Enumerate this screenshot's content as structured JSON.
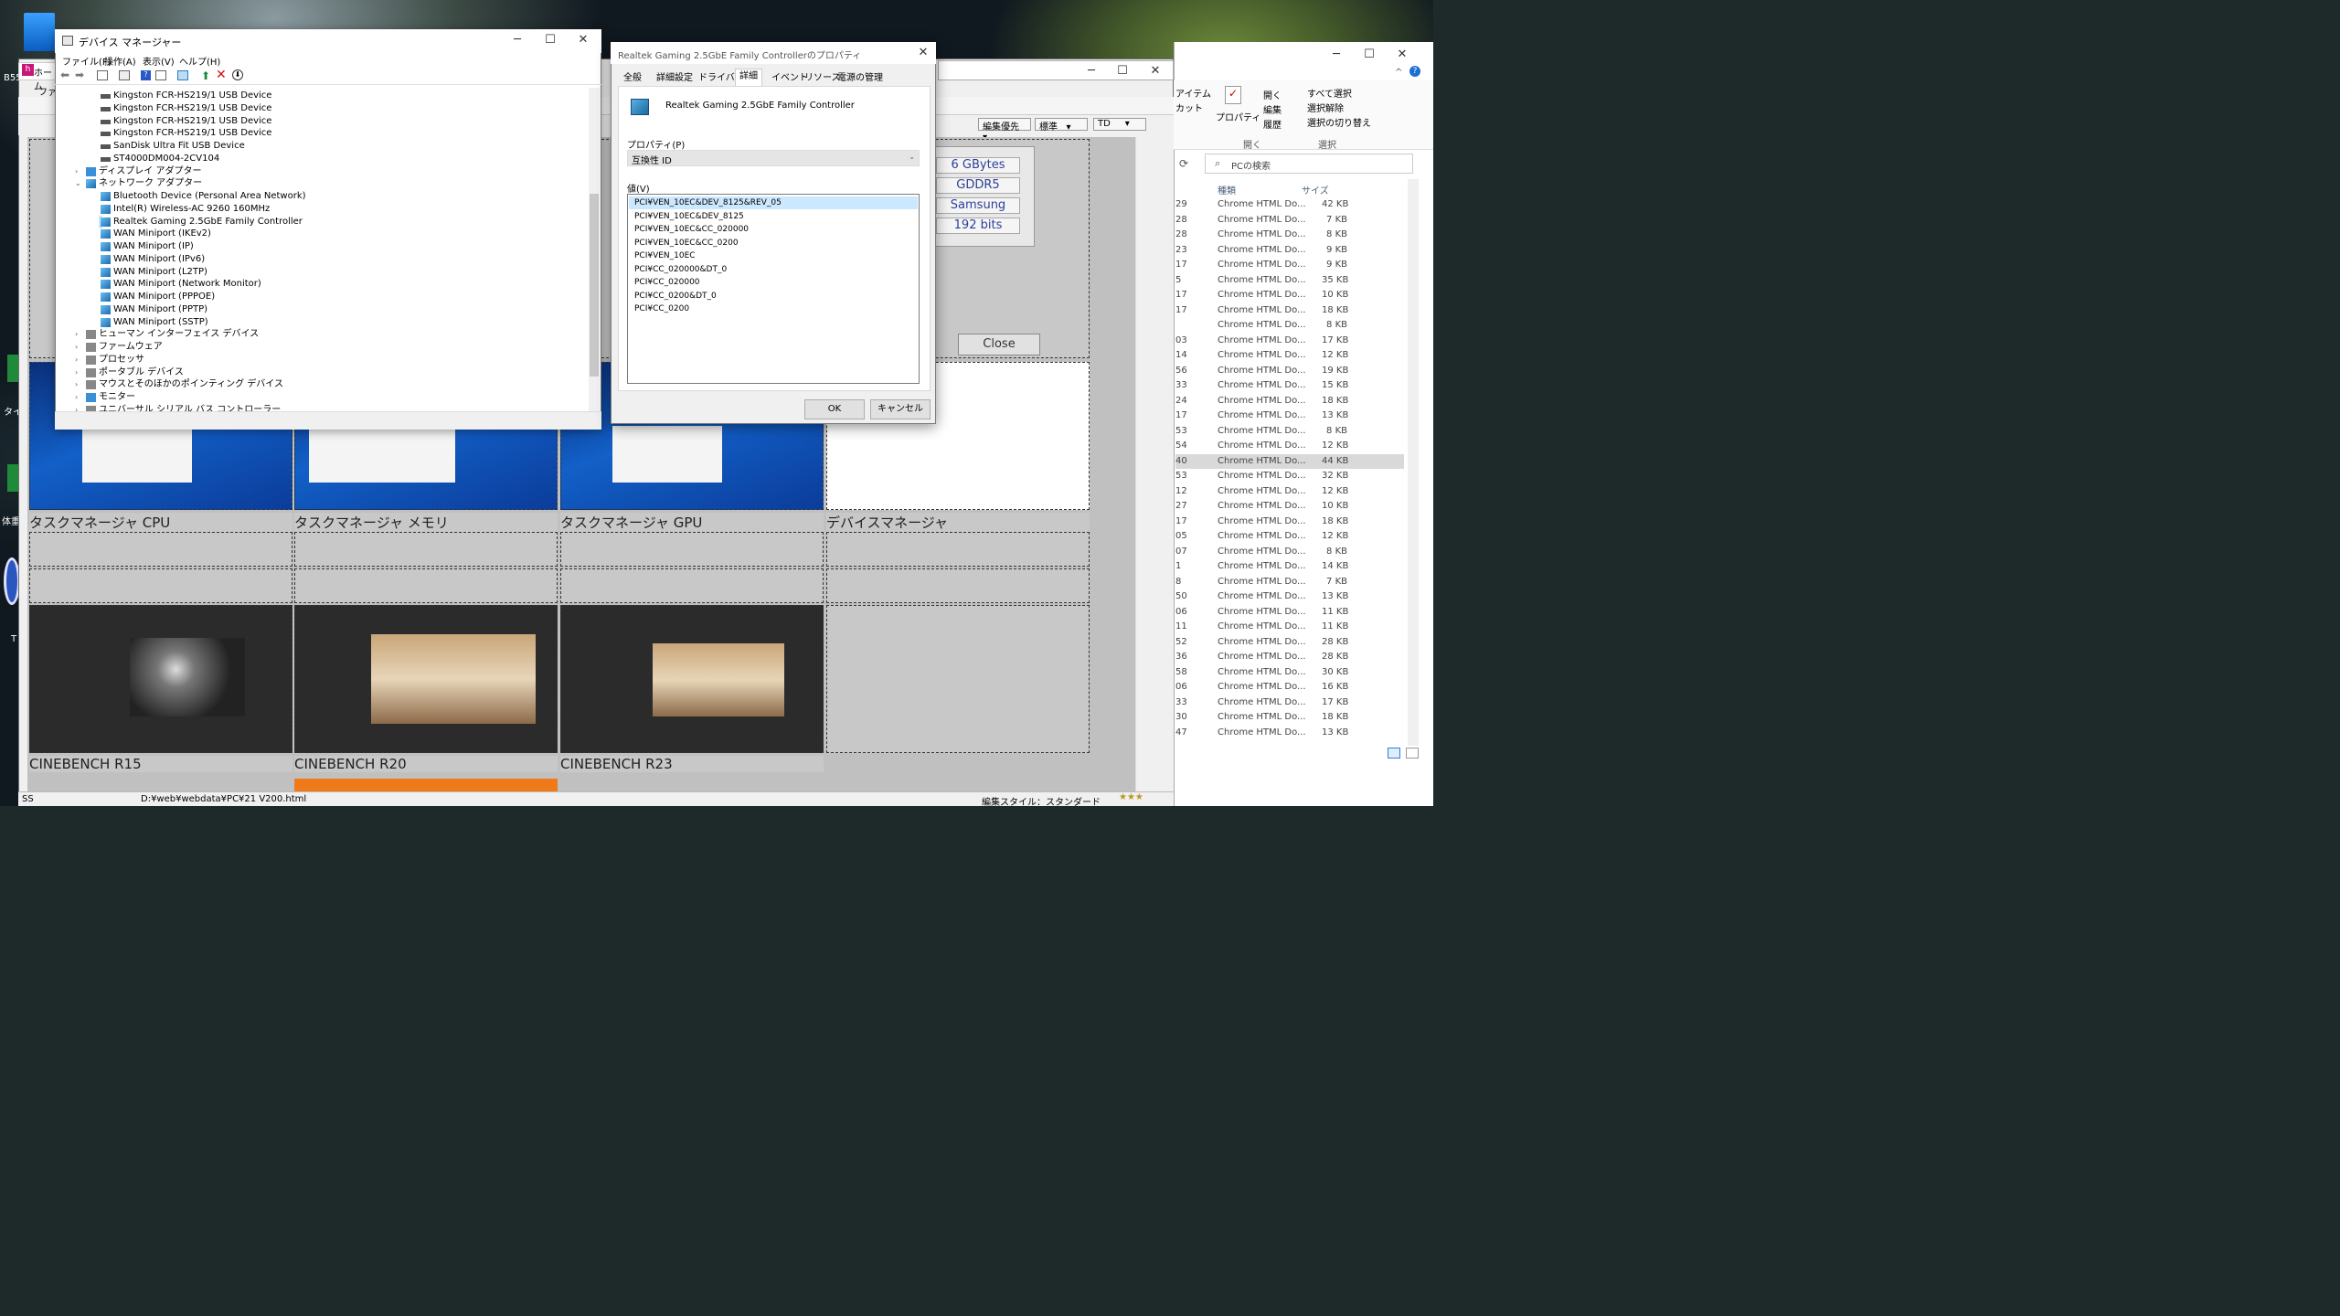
{
  "device_manager": {
    "title": "デバイス マネージャー",
    "menu": [
      "ファイル(F)",
      "操作(A)",
      "表示(V)",
      "ヘルプ(H)"
    ],
    "tree": [
      {
        "label": "Kingston FCR-HS219/1 USB Device",
        "level": 2,
        "icon": "drive-icon"
      },
      {
        "label": "Kingston FCR-HS219/1 USB Device",
        "level": 2,
        "icon": "drive-icon"
      },
      {
        "label": "Kingston FCR-HS219/1 USB Device",
        "level": 2,
        "icon": "drive-icon"
      },
      {
        "label": "Kingston FCR-HS219/1 USB Device",
        "level": 2,
        "icon": "drive-icon"
      },
      {
        "label": "SanDisk Ultra Fit USB Device",
        "level": 2,
        "icon": "drive-icon"
      },
      {
        "label": "ST4000DM004-2CV104",
        "level": 2,
        "icon": "drive-icon"
      },
      {
        "label": "ディスプレイ アダプター",
        "level": 1,
        "icon": "display-adapter-icon",
        "expander": ">"
      },
      {
        "label": "ネットワーク アダプター",
        "level": 1,
        "icon": "network-adapter-icon",
        "expander": "v"
      },
      {
        "label": "Bluetooth Device (Personal Area Network)",
        "level": 2,
        "icon": "network-icon"
      },
      {
        "label": "Intel(R) Wireless-AC 9260 160MHz",
        "level": 2,
        "icon": "network-icon"
      },
      {
        "label": "Realtek Gaming 2.5GbE Family Controller",
        "level": 2,
        "icon": "network-icon",
        "selected": true
      },
      {
        "label": "WAN Miniport (IKEv2)",
        "level": 2,
        "icon": "network-icon"
      },
      {
        "label": "WAN Miniport (IP)",
        "level": 2,
        "icon": "network-icon"
      },
      {
        "label": "WAN Miniport (IPv6)",
        "level": 2,
        "icon": "network-icon"
      },
      {
        "label": "WAN Miniport (L2TP)",
        "level": 2,
        "icon": "network-icon"
      },
      {
        "label": "WAN Miniport (Network Monitor)",
        "level": 2,
        "icon": "network-icon"
      },
      {
        "label": "WAN Miniport (PPPOE)",
        "level": 2,
        "icon": "network-icon"
      },
      {
        "label": "WAN Miniport (PPTP)",
        "level": 2,
        "icon": "network-icon"
      },
      {
        "label": "WAN Miniport (SSTP)",
        "level": 2,
        "icon": "network-icon"
      },
      {
        "label": "ヒューマン インターフェイス デバイス",
        "level": 1,
        "icon": "hid-icon",
        "expander": ">"
      },
      {
        "label": "ファームウェア",
        "level": 1,
        "icon": "firmware-icon",
        "expander": ">"
      },
      {
        "label": "プロセッサ",
        "level": 1,
        "icon": "processor-icon",
        "expander": ">"
      },
      {
        "label": "ポータブル デバイス",
        "level": 1,
        "icon": "portable-device-icon",
        "expander": ">"
      },
      {
        "label": "マウスとそのほかのポインティング デバイス",
        "level": 1,
        "icon": "mouse-icon",
        "expander": ">"
      },
      {
        "label": "モニター",
        "level": 1,
        "icon": "monitor-icon",
        "expander": ">"
      },
      {
        "label": "ユニバーサル シリアル バス コントローラー",
        "level": 1,
        "icon": "usb-icon",
        "expander": ">"
      }
    ]
  },
  "properties": {
    "title": "Realtek Gaming 2.5GbE Family Controllerのプロパティ",
    "tabs": [
      "全般",
      "詳細設定",
      "ドライバー",
      "詳細",
      "イベント",
      "リソース",
      "電源の管理"
    ],
    "active_tab": "詳細",
    "device_name": "Realtek Gaming 2.5GbE Family Controller",
    "property_label": "プロパティ(P)",
    "property_value": "互換性 ID",
    "value_label": "値(V)",
    "values": [
      "PCI¥VEN_10EC&DEV_8125&REV_05",
      "PCI¥VEN_10EC&DEV_8125",
      "PCI¥VEN_10EC&CC_020000",
      "PCI¥VEN_10EC&CC_0200",
      "PCI¥VEN_10EC",
      "PCI¥CC_020000&DT_0",
      "PCI¥CC_020000",
      "PCI¥CC_0200&DT_0",
      "PCI¥CC_0200"
    ],
    "ok": "OK",
    "cancel": "キャンセル"
  },
  "editor": {
    "tab_label": "ホーム",
    "menu_label": "ファ",
    "dropdowns": [
      "編集優先",
      "標準",
      "TD"
    ],
    "gpu_spec": [
      "6 GBytes",
      "GDDR5",
      "Samsung",
      "192 bits"
    ],
    "close_label": "Close",
    "captions_row1": [
      "タスクマネージャ CPU",
      "タスクマネージャ メモリ",
      "タスクマネージャ GPU",
      "デバイスマネージャ"
    ],
    "captions_row2": [
      "CINEBENCH R15",
      "CINEBENCH R20",
      "CINEBENCH R23"
    ],
    "status_left": "SS",
    "status_path": "D:¥web¥webdata¥PC¥21 V200.html",
    "status_style": "編集スタイル：スタンダード"
  },
  "explorer": {
    "ribbon": {
      "items_label": "アイテム",
      "cut_label": "カット",
      "properties_label": "プロパティ",
      "open_label": "開く",
      "edit_label": "編集",
      "history_label": "履歴",
      "select_all": "すべて選択",
      "select_none": "選択解除",
      "invert_selection": "選択の切り替え",
      "group_open": "開く",
      "group_select": "選択"
    },
    "search_placeholder": "PCの検索",
    "columns": [
      "種類",
      "サイズ"
    ],
    "rows": [
      {
        "n": "29",
        "type": "Chrome HTML Do...",
        "size": "42 KB"
      },
      {
        "n": "28",
        "type": "Chrome HTML Do...",
        "size": "7 KB"
      },
      {
        "n": "28",
        "type": "Chrome HTML Do...",
        "size": "8 KB"
      },
      {
        "n": "23",
        "type": "Chrome HTML Do...",
        "size": "9 KB"
      },
      {
        "n": "17",
        "type": "Chrome HTML Do...",
        "size": "9 KB"
      },
      {
        "n": "5",
        "type": "Chrome HTML Do...",
        "size": "35 KB"
      },
      {
        "n": "17",
        "type": "Chrome HTML Do...",
        "size": "10 KB"
      },
      {
        "n": "17",
        "type": "Chrome HTML Do...",
        "size": "18 KB"
      },
      {
        "n": "",
        "type": "Chrome HTML Do...",
        "size": "8 KB"
      },
      {
        "n": "03",
        "type": "Chrome HTML Do...",
        "size": "17 KB"
      },
      {
        "n": "14",
        "type": "Chrome HTML Do...",
        "size": "12 KB"
      },
      {
        "n": "56",
        "type": "Chrome HTML Do...",
        "size": "19 KB"
      },
      {
        "n": "33",
        "type": "Chrome HTML Do...",
        "size": "15 KB"
      },
      {
        "n": "24",
        "type": "Chrome HTML Do...",
        "size": "18 KB"
      },
      {
        "n": "17",
        "type": "Chrome HTML Do...",
        "size": "13 KB"
      },
      {
        "n": "53",
        "type": "Chrome HTML Do...",
        "size": "8 KB"
      },
      {
        "n": "54",
        "type": "Chrome HTML Do...",
        "size": "12 KB"
      },
      {
        "n": "40",
        "type": "Chrome HTML Do...",
        "size": "44 KB",
        "selected": true
      },
      {
        "n": "53",
        "type": "Chrome HTML Do...",
        "size": "32 KB"
      },
      {
        "n": "12",
        "type": "Chrome HTML Do...",
        "size": "12 KB"
      },
      {
        "n": "27",
        "type": "Chrome HTML Do...",
        "size": "10 KB"
      },
      {
        "n": "17",
        "type": "Chrome HTML Do...",
        "size": "18 KB"
      },
      {
        "n": "05",
        "type": "Chrome HTML Do...",
        "size": "12 KB"
      },
      {
        "n": "07",
        "type": "Chrome HTML Do...",
        "size": "8 KB"
      },
      {
        "n": "1",
        "type": "Chrome HTML Do...",
        "size": "14 KB"
      },
      {
        "n": "8",
        "type": "Chrome HTML Do...",
        "size": "7 KB"
      },
      {
        "n": "50",
        "type": "Chrome HTML Do...",
        "size": "13 KB"
      },
      {
        "n": "06",
        "type": "Chrome HTML Do...",
        "size": "11 KB"
      },
      {
        "n": "11",
        "type": "Chrome HTML Do...",
        "size": "11 KB"
      },
      {
        "n": "52",
        "type": "Chrome HTML Do...",
        "size": "28 KB"
      },
      {
        "n": "36",
        "type": "Chrome HTML Do...",
        "size": "28 KB"
      },
      {
        "n": "58",
        "type": "Chrome HTML Do...",
        "size": "30 KB"
      },
      {
        "n": "06",
        "type": "Chrome HTML Do...",
        "size": "16 KB"
      },
      {
        "n": "33",
        "type": "Chrome HTML Do...",
        "size": "17 KB"
      },
      {
        "n": "30",
        "type": "Chrome HTML Do...",
        "size": "18 KB"
      },
      {
        "n": "47",
        "type": "Chrome HTML Do...",
        "size": "13 KB"
      }
    ]
  },
  "desktop": {
    "labels": [
      "B55",
      "タイ",
      "体重",
      "T"
    ]
  },
  "colors": {
    "selection": "#cce8ff",
    "spec_text": "#2c3f9a",
    "explorer_selected": "#d9d9d9"
  }
}
